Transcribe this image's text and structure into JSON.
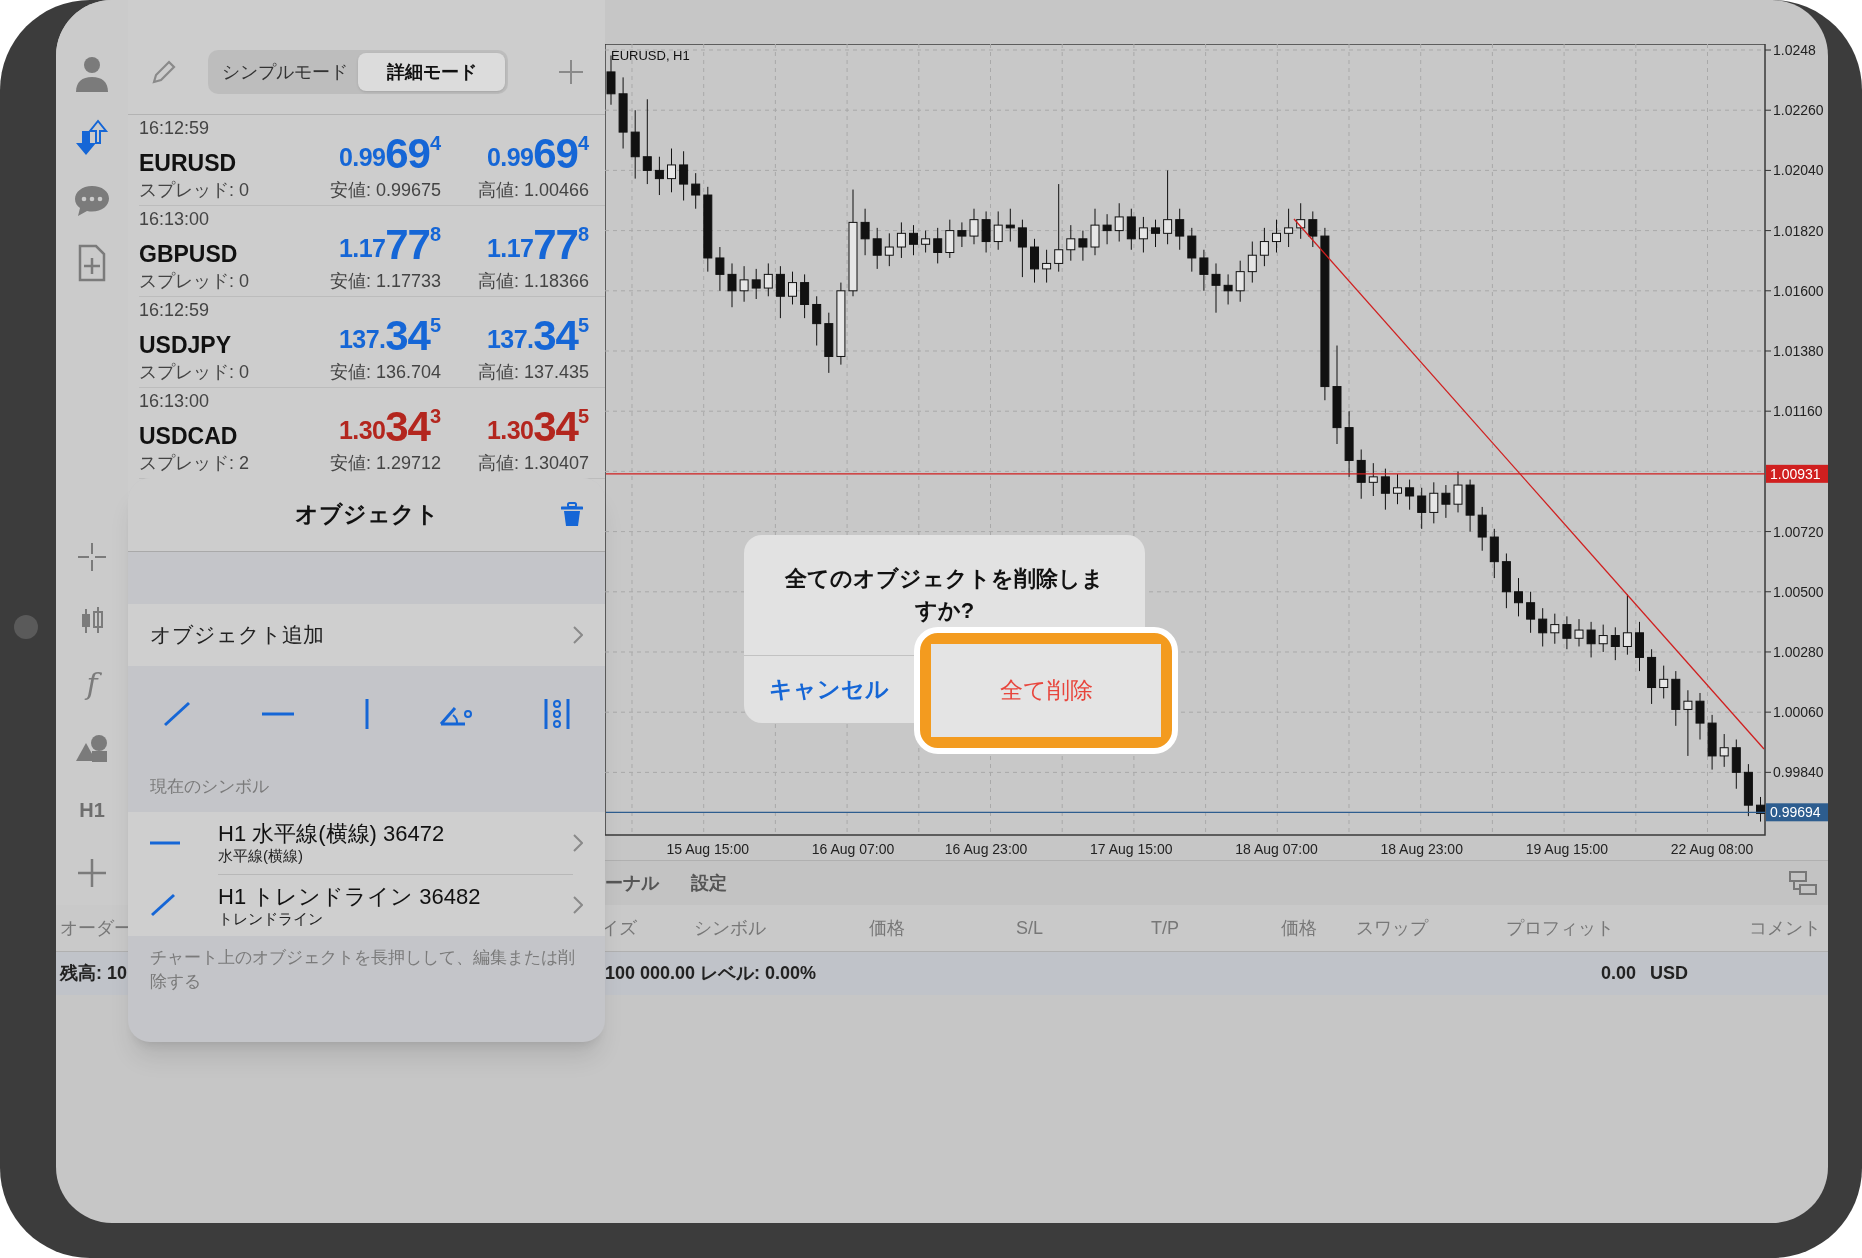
{
  "mode_tabs": [
    {
      "label": "シンプルモード",
      "selected": false
    },
    {
      "label": "詳細モード",
      "selected": true
    }
  ],
  "quotes": [
    {
      "time": "16:12:59",
      "symbol": "EURUSD",
      "spread": "スプレッド: 0",
      "bid": {
        "prefix": "0.99",
        "big": "69",
        "sup": "4"
      },
      "low": "安値: 0.99675",
      "ask": {
        "prefix": "0.99",
        "big": "69",
        "sup": "4"
      },
      "high": "高値: 1.00466",
      "color": "#1566d6"
    },
    {
      "time": "16:13:00",
      "symbol": "GBPUSD",
      "spread": "スプレッド: 0",
      "bid": {
        "prefix": "1.17",
        "big": "77",
        "sup": "8"
      },
      "low": "安値: 1.17733",
      "ask": {
        "prefix": "1.17",
        "big": "77",
        "sup": "8"
      },
      "high": "高値: 1.18366",
      "color": "#1566d6"
    },
    {
      "time": "16:12:59",
      "symbol": "USDJPY",
      "spread": "スプレッド: 0",
      "bid": {
        "prefix": "137.",
        "big": "34",
        "sup": "5"
      },
      "low": "安値: 136.704",
      "ask": {
        "prefix": "137.",
        "big": "34",
        "sup": "5"
      },
      "high": "高値: 137.435",
      "color": "#1566d6"
    },
    {
      "time": "16:13:00",
      "symbol": "USDCAD",
      "spread": "スプレッド: 2",
      "bid": {
        "prefix": "1.30",
        "big": "34",
        "sup": "3"
      },
      "low": "安値: 1.29712",
      "ask": {
        "prefix": "1.30",
        "big": "34",
        "sup": "5"
      },
      "high": "高値: 1.30407",
      "color": "#b3261e"
    }
  ],
  "rail": {
    "indicator_glyph": "f",
    "timeframe": "H1"
  },
  "chart": {
    "title": "EURUSD, H1",
    "chart_data": {
      "type": "candlestick",
      "grid": true,
      "ref_lines": [
        {
          "axis": "y",
          "value": 1.00931,
          "color": "#d01f1f",
          "label": "1.00931"
        },
        {
          "axis": "y",
          "value": 0.99694,
          "color": "#2d5d8f",
          "label": "0.99694"
        }
      ],
      "yticks": [
        {
          "value": 1.0248,
          "label": "1.0248"
        },
        {
          "value": 1.0226,
          "label": "1.02260"
        },
        {
          "value": 1.0204,
          "label": "1.02040"
        },
        {
          "value": 1.0182,
          "label": "1.01820"
        },
        {
          "value": 1.016,
          "label": "1.01600"
        },
        {
          "value": 1.0138,
          "label": "1.01380"
        },
        {
          "value": 1.0116,
          "label": "1.01160"
        },
        {
          "value": 1.0072,
          "label": "1.00720"
        },
        {
          "value": 1.005,
          "label": "1.00500"
        },
        {
          "value": 1.0028,
          "label": "1.00280"
        },
        {
          "value": 1.0006,
          "label": "1.00060"
        },
        {
          "value": 0.9984,
          "label": "0.99840"
        }
      ],
      "ylim": [
        0.99611,
        1.02502
      ],
      "categories": [
        null,
        null,
        null,
        null,
        null,
        null,
        null,
        null,
        "15 Aug 15:00",
        null,
        null,
        null,
        null,
        null,
        null,
        null,
        null,
        null,
        null,
        null,
        "16 Aug 07:00",
        null,
        null,
        null,
        null,
        null,
        null,
        null,
        null,
        null,
        null,
        "16 Aug 23:00",
        null,
        null,
        null,
        null,
        null,
        null,
        null,
        null,
        null,
        null,
        null,
        "17 Aug 15:00",
        null,
        null,
        null,
        null,
        null,
        null,
        null,
        null,
        null,
        null,
        null,
        "18 Aug 07:00",
        null,
        null,
        null,
        null,
        null,
        null,
        null,
        null,
        null,
        null,
        null,
        "18 Aug 23:00",
        null,
        null,
        null,
        null,
        null,
        null,
        null,
        null,
        null,
        null,
        null,
        "19 Aug 15:00",
        null,
        null,
        null,
        null,
        null,
        null,
        null,
        null,
        null,
        null,
        null,
        "22 Aug 08:00",
        null,
        null,
        null,
        null
      ],
      "ohlc": [
        [
          1.024,
          1.0246,
          1.0228,
          1.0232
        ],
        [
          1.0232,
          1.0238,
          1.0212,
          1.0218
        ],
        [
          1.0218,
          1.0226,
          1.0201,
          1.0209
        ],
        [
          1.0209,
          1.023,
          1.0199,
          1.0204
        ],
        [
          1.0204,
          1.0209,
          1.0195,
          1.0201
        ],
        [
          1.0201,
          1.0212,
          1.0196,
          1.0206
        ],
        [
          1.0206,
          1.0211,
          1.0193,
          1.0199
        ],
        [
          1.0199,
          1.0203,
          1.019,
          1.0195
        ],
        [
          1.0195,
          1.0198,
          1.0167,
          1.0172
        ],
        [
          1.0172,
          1.0176,
          1.016,
          1.0166
        ],
        [
          1.0166,
          1.017,
          1.0154,
          1.016
        ],
        [
          1.016,
          1.0169,
          1.0156,
          1.0164
        ],
        [
          1.0164,
          1.0168,
          1.0157,
          1.0161
        ],
        [
          1.0161,
          1.017,
          1.0158,
          1.0166
        ],
        [
          1.0166,
          1.0169,
          1.015,
          1.0158
        ],
        [
          1.0158,
          1.0167,
          1.0155,
          1.0163
        ],
        [
          1.0163,
          1.0166,
          1.015,
          1.0155
        ],
        [
          1.0155,
          1.0158,
          1.014,
          1.0148
        ],
        [
          1.0148,
          1.0152,
          1.013,
          1.0136
        ],
        [
          1.0136,
          1.0163,
          1.0133,
          1.016
        ],
        [
          1.016,
          1.0197,
          1.0158,
          1.0185
        ],
        [
          1.0185,
          1.019,
          1.0173,
          1.0179
        ],
        [
          1.0179,
          1.0183,
          1.0168,
          1.0173
        ],
        [
          1.0173,
          1.0181,
          1.0169,
          1.0176
        ],
        [
          1.0176,
          1.0185,
          1.0172,
          1.0181
        ],
        [
          1.0181,
          1.0184,
          1.0173,
          1.0177
        ],
        [
          1.0177,
          1.0182,
          1.0174,
          1.0179
        ],
        [
          1.0179,
          1.0183,
          1.017,
          1.0174
        ],
        [
          1.0174,
          1.0186,
          1.0172,
          1.0182
        ],
        [
          1.0182,
          1.0185,
          1.0176,
          1.018
        ],
        [
          1.018,
          1.019,
          1.0177,
          1.0186
        ],
        [
          1.0186,
          1.0189,
          1.0174,
          1.0178
        ],
        [
          1.0178,
          1.0189,
          1.0175,
          1.0184
        ],
        [
          1.0184,
          1.019,
          1.0178,
          1.0183
        ],
        [
          1.0183,
          1.0186,
          1.0165,
          1.0176
        ],
        [
          1.0176,
          1.0179,
          1.0163,
          1.0168
        ],
        [
          1.0168,
          1.0175,
          1.0163,
          1.017
        ],
        [
          1.017,
          1.0199,
          1.0167,
          1.0175
        ],
        [
          1.0175,
          1.0184,
          1.0171,
          1.0179
        ],
        [
          1.0179,
          1.0182,
          1.0171,
          1.0176
        ],
        [
          1.0176,
          1.019,
          1.0173,
          1.0184
        ],
        [
          1.0184,
          1.0188,
          1.0177,
          1.0182
        ],
        [
          1.0182,
          1.0192,
          1.0178,
          1.0187
        ],
        [
          1.0187,
          1.019,
          1.0175,
          1.0179
        ],
        [
          1.0179,
          1.0187,
          1.0174,
          1.0183
        ],
        [
          1.0183,
          1.0186,
          1.0176,
          1.0181
        ],
        [
          1.0181,
          1.0204,
          1.0177,
          1.0186
        ],
        [
          1.0186,
          1.019,
          1.0175,
          1.018
        ],
        [
          1.018,
          1.0183,
          1.0167,
          1.0172
        ],
        [
          1.0172,
          1.0175,
          1.016,
          1.0166
        ],
        [
          1.0166,
          1.017,
          1.0152,
          1.0162
        ],
        [
          1.0162,
          1.0166,
          1.0155,
          1.016
        ],
        [
          1.016,
          1.0171,
          1.0156,
          1.0167
        ],
        [
          1.0167,
          1.0178,
          1.0163,
          1.0173
        ],
        [
          1.0173,
          1.0183,
          1.0169,
          1.0178
        ],
        [
          1.0178,
          1.0186,
          1.0174,
          1.0181
        ],
        [
          1.0181,
          1.019,
          1.0176,
          1.0183
        ],
        [
          1.0183,
          1.0192,
          1.0179,
          1.0186
        ],
        [
          1.0186,
          1.0189,
          1.0176,
          1.018
        ],
        [
          1.018,
          1.0183,
          1.012,
          1.0125
        ],
        [
          1.0125,
          1.014,
          1.0104,
          1.011
        ],
        [
          1.011,
          1.0116,
          1.0092,
          1.0098
        ],
        [
          1.0098,
          1.0102,
          1.0084,
          1.009
        ],
        [
          1.009,
          1.0097,
          1.0085,
          1.0092
        ],
        [
          1.0092,
          1.0095,
          1.008,
          1.0086
        ],
        [
          1.0086,
          1.0093,
          1.0082,
          1.0088
        ],
        [
          1.0088,
          1.0091,
          1.008,
          1.0085
        ],
        [
          1.0085,
          1.0088,
          1.0073,
          1.0079
        ],
        [
          1.0079,
          1.009,
          1.0075,
          1.0086
        ],
        [
          1.0086,
          1.0089,
          1.0077,
          1.0082
        ],
        [
          1.0082,
          1.0094,
          1.0079,
          1.0089
        ],
        [
          1.0089,
          1.0091,
          1.0072,
          1.0078
        ],
        [
          1.0078,
          1.0081,
          1.0065,
          1.007
        ],
        [
          1.007,
          1.0073,
          1.0055,
          1.0061
        ],
        [
          1.0061,
          1.0064,
          1.0044,
          1.005
        ],
        [
          1.005,
          1.0055,
          1.0041,
          1.0046
        ],
        [
          1.0046,
          1.005,
          1.0035,
          1.004
        ],
        [
          1.004,
          1.0044,
          1.003,
          1.0035
        ],
        [
          1.0035,
          1.0042,
          1.0031,
          1.0038
        ],
        [
          1.0038,
          1.0041,
          1.0029,
          1.0033
        ],
        [
          1.0033,
          1.004,
          1.003,
          1.0036
        ],
        [
          1.0036,
          1.0039,
          1.0026,
          1.0031
        ],
        [
          1.0031,
          1.0038,
          1.0028,
          1.0034
        ],
        [
          1.0034,
          1.0037,
          1.0025,
          1.003
        ],
        [
          1.003,
          1.0049,
          1.0027,
          1.0035
        ],
        [
          1.0035,
          1.0039,
          1.0021,
          1.0026
        ],
        [
          1.0026,
          1.0029,
          1.0009,
          1.0015
        ],
        [
          1.0015,
          1.0023,
          1.0011,
          1.0018
        ],
        [
          1.0018,
          1.0021,
          1.0001,
          1.0007
        ],
        [
          1.0007,
          1.0014,
          0.999,
          1.001
        ],
        [
          1.001,
          1.0013,
          0.9996,
          1.0002
        ],
        [
          1.0002,
          1.0005,
          0.9985,
          0.999
        ],
        [
          0.999,
          0.9998,
          0.9986,
          0.9993
        ],
        [
          0.9993,
          0.9996,
          0.9978,
          0.9984
        ],
        [
          0.9984,
          0.9987,
          0.9968,
          0.9972
        ],
        [
          0.9972,
          0.9975,
          0.9966,
          0.9969
        ]
      ]
    }
  },
  "toolbox": {
    "tabs": [
      "ーナル",
      "設定"
    ],
    "columns": [
      "オーダー",
      "イズ",
      "シンボル",
      "価格",
      "S/L",
      "T/P",
      "価格",
      "スワップ",
      "プロフィット",
      "コメント"
    ],
    "balance": {
      "left": "残高: 10",
      "summary": "100 000.00 レベル: 0.00%",
      "profit": "0.00",
      "currency": "USD"
    }
  },
  "objects_panel": {
    "title": "オブジェクト",
    "add_label": "オブジェクト追加",
    "section": "現在のシンボル",
    "items": [
      {
        "kind": "horizontal",
        "title": "H1 水平線(横線) 36472",
        "subtitle": "水平線(横線)"
      },
      {
        "kind": "trend",
        "title": "H1 トレンドライン 36482",
        "subtitle": "トレンドライン"
      }
    ],
    "hint": "チャート上のオブジェクトを長押しして、編集または削除する"
  },
  "dialog": {
    "title": "全てのオブジェクトを削除しますか?",
    "cancel": "キャンセル",
    "confirm": "全て削除"
  }
}
